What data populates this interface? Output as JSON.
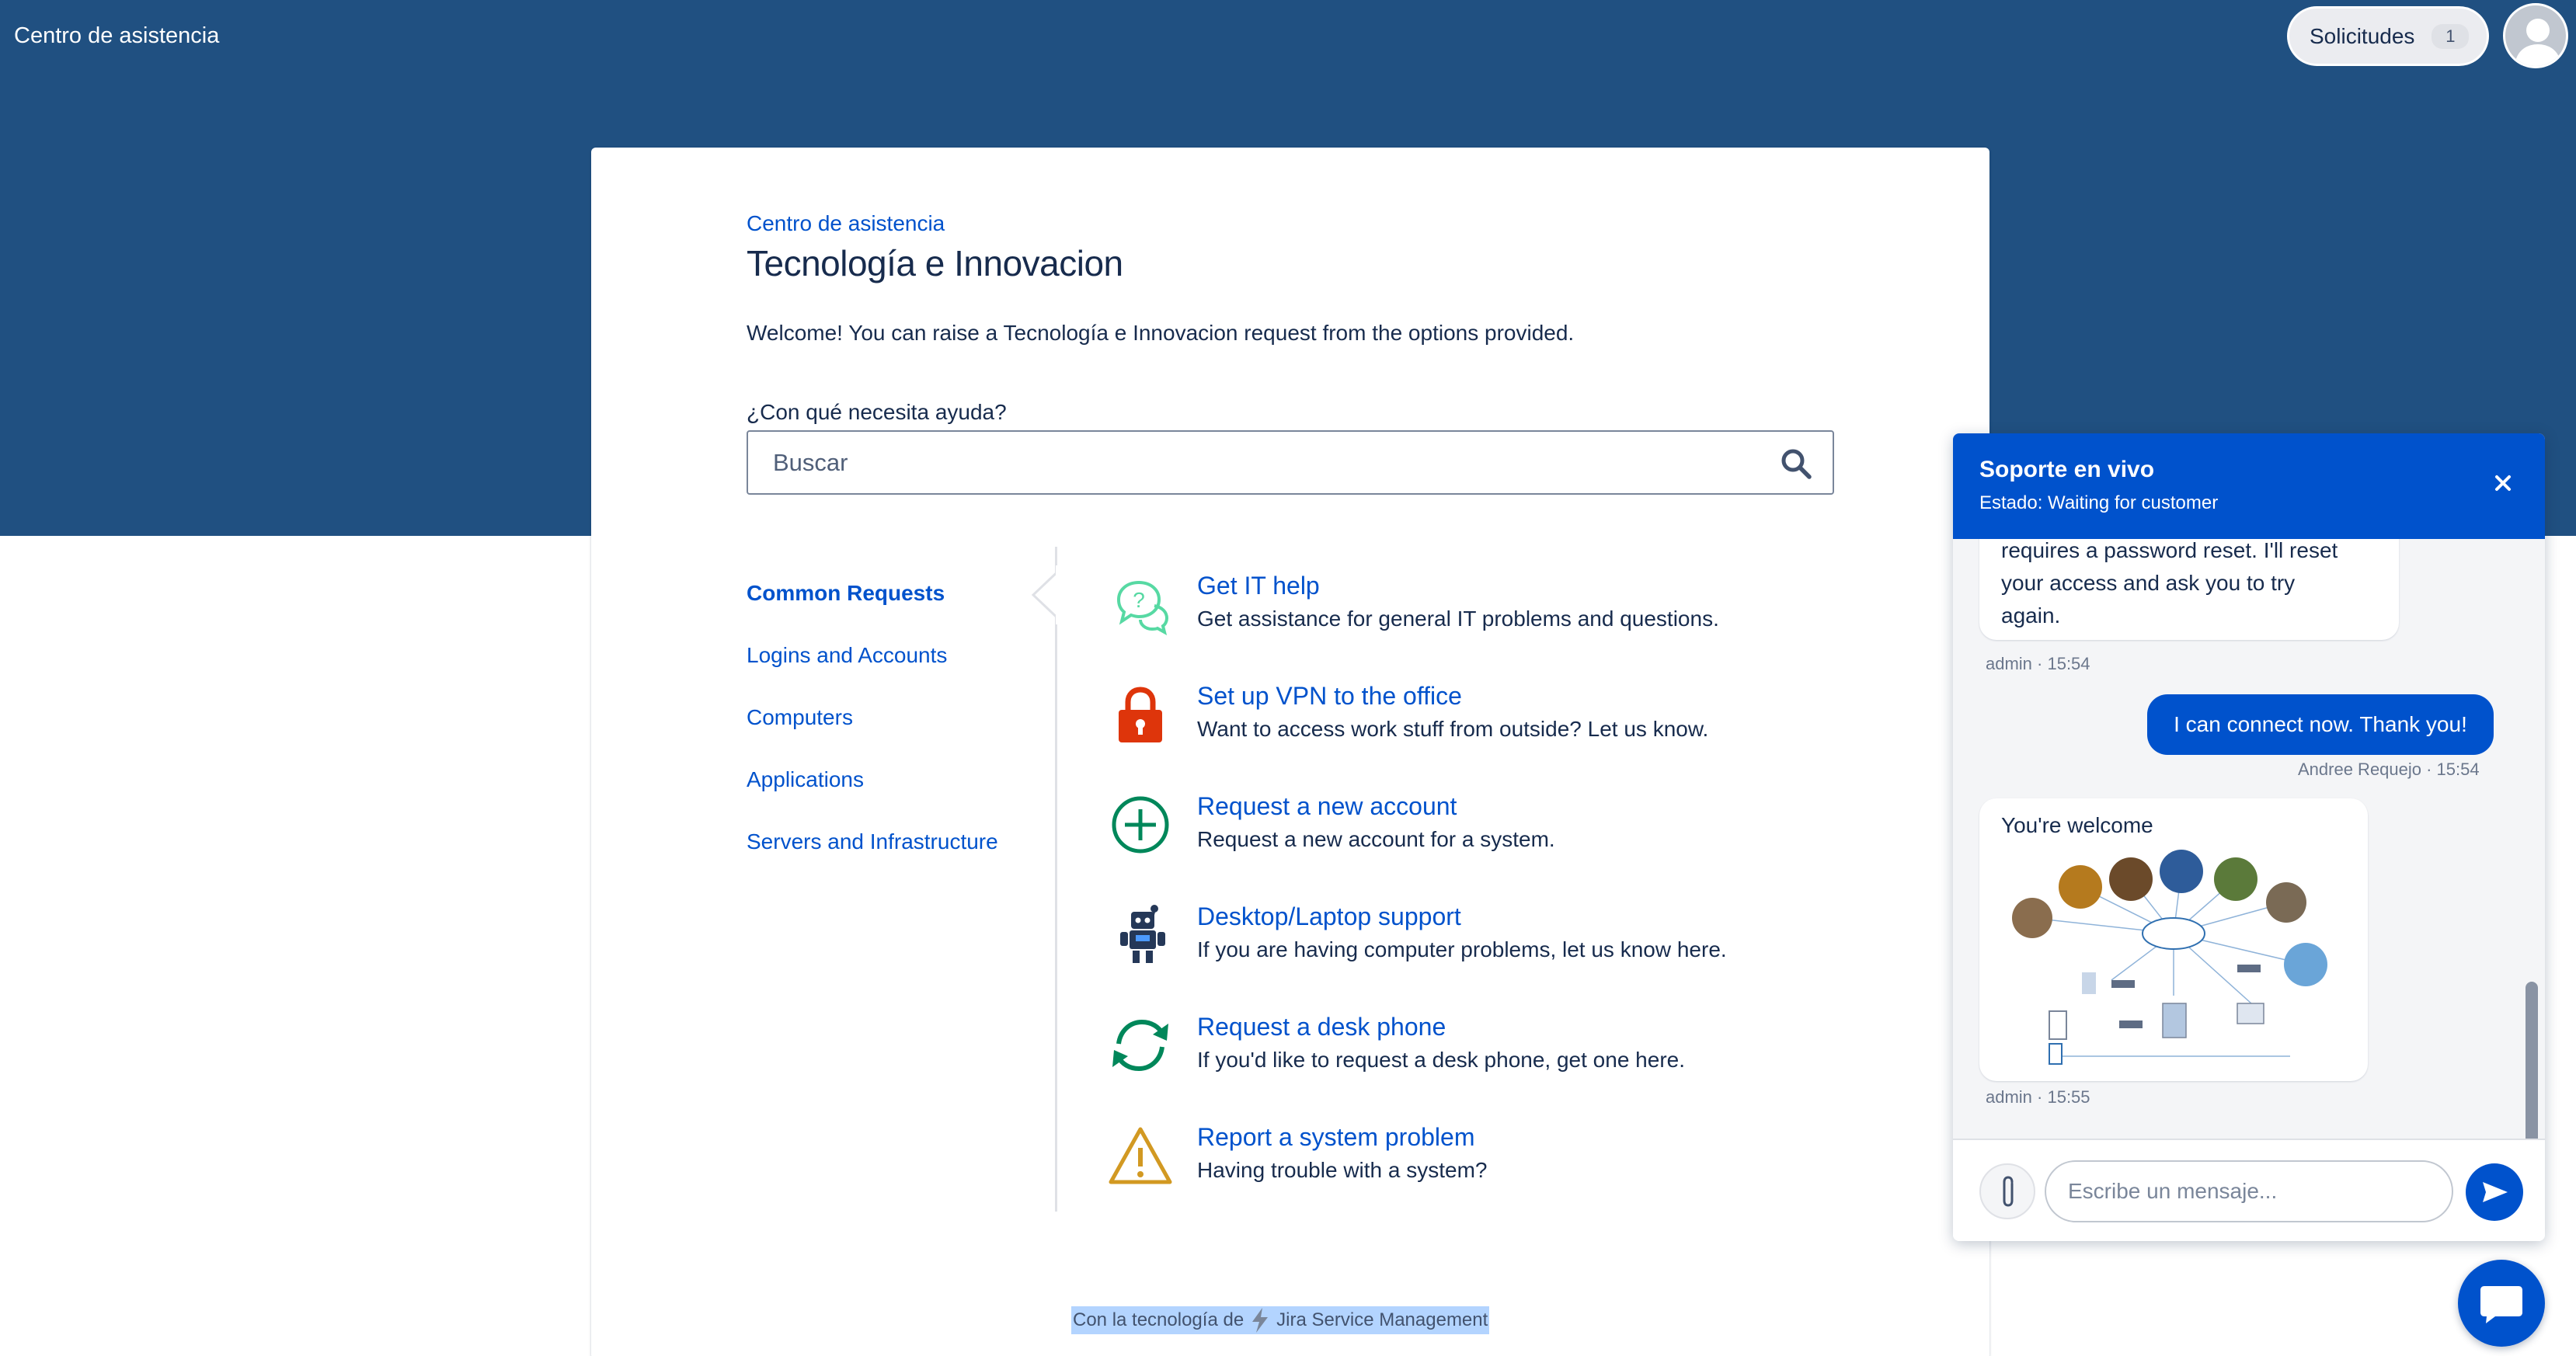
{
  "header": {
    "site_title": "Centro de asistencia",
    "requests_label": "Solicitudes",
    "requests_count": "1"
  },
  "portal": {
    "breadcrumb": "Centro de asistencia",
    "title": "Tecnología e Innovacion",
    "welcome": "Welcome! You can raise a Tecnología e Innovacion request from the options provided.",
    "search_label": "¿Con qué necesita ayuda?",
    "search_placeholder": "Buscar"
  },
  "groups": [
    {
      "label": "Common Requests",
      "active": true
    },
    {
      "label": "Logins and Accounts"
    },
    {
      "label": "Computers"
    },
    {
      "label": "Applications"
    },
    {
      "label": "Servers and Infrastructure"
    }
  ],
  "request_types": [
    {
      "title": "Get IT help",
      "description": "Get assistance for general IT problems and questions.",
      "icon": "question-bubbles-icon"
    },
    {
      "title": "Set up VPN to the office",
      "description": "Want to access work stuff from outside? Let us know.",
      "icon": "padlock-icon"
    },
    {
      "title": "Request a new account",
      "description": "Request a new account for a system.",
      "icon": "plus-circle-icon"
    },
    {
      "title": "Desktop/Laptop support",
      "description": "If you are having computer problems, let us know here.",
      "icon": "robot-icon"
    },
    {
      "title": "Request a desk phone",
      "description": "If you'd like to request a desk phone, get one here.",
      "icon": "refresh-arrows-icon"
    },
    {
      "title": "Report a system problem",
      "description": "Having trouble with a system?",
      "icon": "warning-triangle-icon"
    }
  ],
  "footer": {
    "prefix": "Con la tecnología de",
    "product": "Jira Service Management"
  },
  "chat": {
    "title": "Soporte en vivo",
    "status": "Estado: Waiting for customer",
    "messages": [
      {
        "lines": [
          "requires a password reset. I'll reset",
          "your access and ask you to try",
          "again."
        ],
        "meta": "admin · 15:54"
      },
      {
        "text": "I can connect now. Thank you!",
        "meta": "Andree Requejo · 15:54"
      },
      {
        "text": "You're welcome",
        "meta": "admin · 15:55"
      }
    ],
    "input_placeholder": "Escribe un mensaje..."
  },
  "colors": {
    "hero": "#205081",
    "link": "#0052cc",
    "chat_header": "#0052cc",
    "vpn_red": "#de350b",
    "green": "#00875a",
    "warning": "#d29922"
  }
}
